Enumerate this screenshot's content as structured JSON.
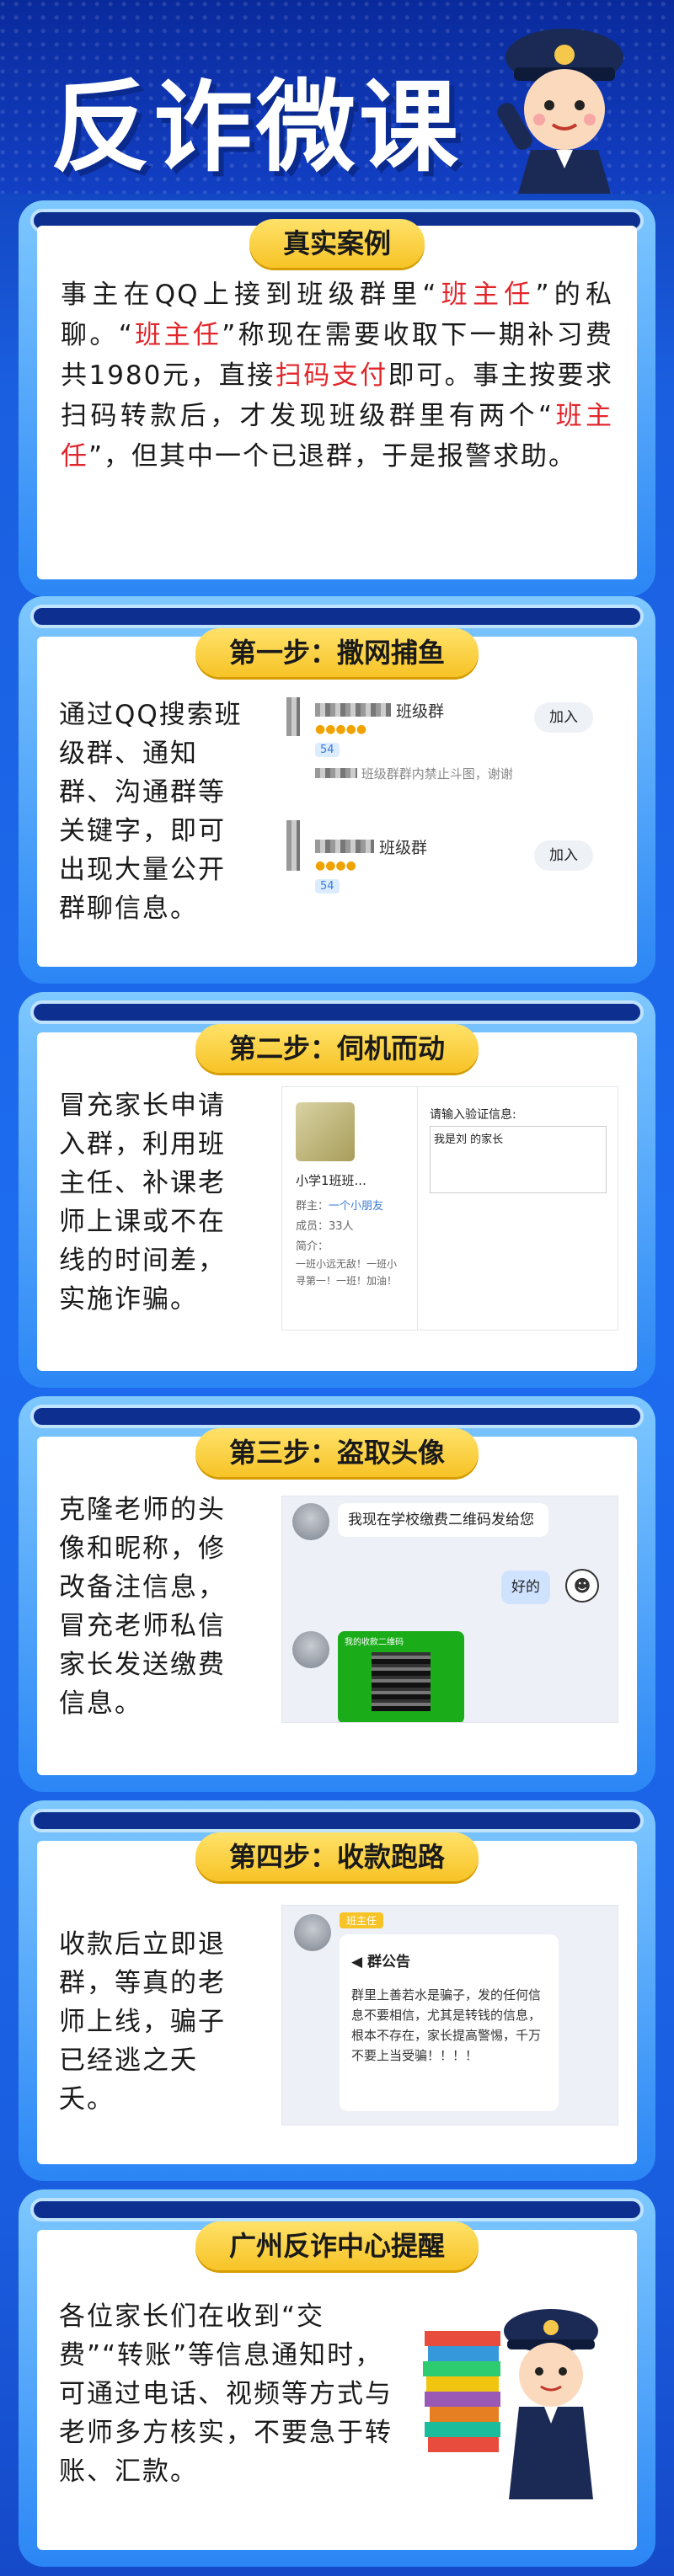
{
  "header": {
    "title": "反诈微课"
  },
  "case": {
    "title": "真实案例",
    "segments": [
      {
        "text": "事主在QQ上接到班级群里“",
        "red": false
      },
      {
        "text": "班主任",
        "red": true
      },
      {
        "text": "”的私聊。“",
        "red": false
      },
      {
        "text": "班主任",
        "red": true
      },
      {
        "text": "”称现在需要收取下一期补习费共1980元，直接",
        "red": false
      },
      {
        "text": "扫码支付",
        "red": true
      },
      {
        "text": "即可。事主按要求扫码转款后，才发现班级群里有两个“",
        "red": false
      },
      {
        "text": "班主任",
        "red": true
      },
      {
        "text": "”，但其中一个已退群，于是报警求助。",
        "red": false
      }
    ]
  },
  "step1": {
    "title": "第一步：撒网捕鱼",
    "text": "通过QQ搜索班级群、通知群、沟通群等关键字，即可出现大量公开群聊信息。",
    "group1_name": "班级群",
    "group1_desc": "班级群群内禁止斗图，谢谢",
    "group1_count": "54",
    "group2_name": "班级群",
    "group2_count": "54",
    "join_label": "加入"
  },
  "step2": {
    "title": "第二步：伺机而动",
    "text": "冒充家长申请入群，利用班主任、补课老师上课或不在线的时间差，实施诈骗。",
    "group_name": "小学1班班...",
    "owner_label": "群主：",
    "owner_value": "一个小朋友",
    "members": "成员：33人",
    "intro_label": "简介：",
    "intro_text": "一班小远无敌！一班小寻第一！一班！加油！",
    "verify_label": "请输入验证信息:",
    "verify_value": "我是刘    的家长"
  },
  "step3": {
    "title": "第三步：盗取头像",
    "text": "克隆老师的头像和昵称，修改备注信息，冒充老师私信家长发送缴费信息。",
    "msg1": "我现在学校缴费二维码发给您",
    "reply": "好的",
    "qr_label": "我的收款二维码"
  },
  "step4": {
    "title": "第四步：收款跑路",
    "text": "收款后立即退群，等真的老师上线，骗子已经逃之夭夭。",
    "tag": "班主任",
    "notice_title": "群公告",
    "notice_body": "群里上善若水是骗子，发的任何信息不要相信，尤其是转钱的信息，根本不存在，家长提高警惕，千万不要上当受骗！！！！"
  },
  "reminder": {
    "title": "广州反诈中心提醒",
    "text": "各位家长们在收到“交费”“转账”等信息通知时，可通过电话、视频等方式与老师多方核实，不要急于转账、汇款。"
  }
}
